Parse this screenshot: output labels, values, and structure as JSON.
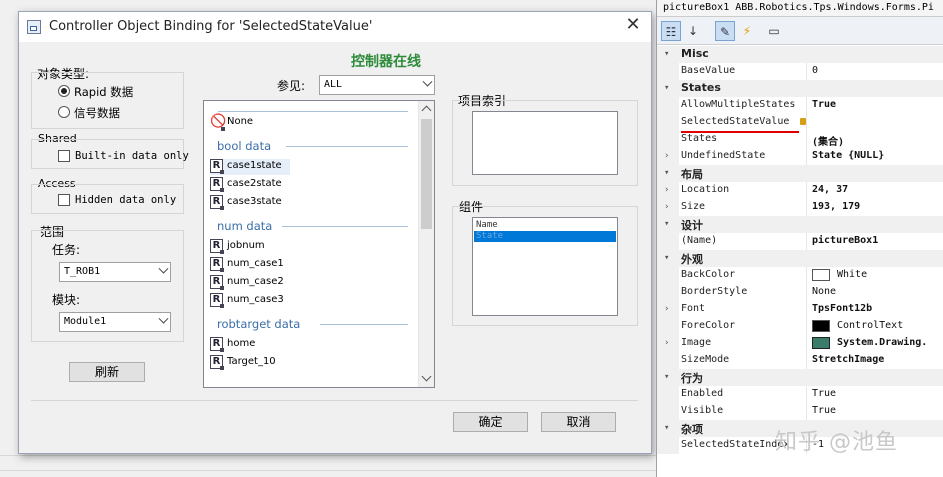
{
  "dialog": {
    "title": "Controller Object Binding for 'SelectedStateValue'",
    "online_label": "控制器在线",
    "object_type": {
      "label": "对象类型:",
      "rapid": "Rapid 数据",
      "signal": "信号数据"
    },
    "shared": {
      "label": "Shared",
      "builtin": "Built-in data only"
    },
    "access": {
      "label": "Access",
      "hidden": "Hidden data only"
    },
    "scope": {
      "label": "范围",
      "task_label": "任务:",
      "task_value": "T_ROB1",
      "module_label": "模块:",
      "module_value": "Module1"
    },
    "refresh_button": "刷新",
    "ref_label": "参见:",
    "ref_value": "ALL",
    "list": {
      "none": "None",
      "bool_header": "bool data",
      "bool_items": [
        "case1state",
        "case2state",
        "case3state"
      ],
      "num_header": "num data",
      "num_items": [
        "jobnum",
        "num_case1",
        "num_case2",
        "num_case3"
      ],
      "robtarget_header": "robtarget data",
      "robtarget_items": [
        "home",
        "Target_10"
      ]
    },
    "item_index_label": "项目索引",
    "component_label": "组件",
    "component_header": "Name",
    "component_selected": "State",
    "ok_button": "确定",
    "cancel_button": "取消"
  },
  "properties": {
    "header": "pictureBox1 ABB.Robotics.Tps.Windows.Forms.Pi",
    "misc": {
      "category": "Misc",
      "base_value_name": "BaseValue",
      "base_value": "0"
    },
    "states": {
      "category": "States",
      "allow_multiple_name": "AllowMultipleStates",
      "allow_multiple_value": "True",
      "selected_state_value_name": "SelectedStateValue",
      "states_name": "States",
      "states_value": "(集合)",
      "undefined_state_name": "UndefinedState",
      "undefined_state_value": "State {NULL}"
    },
    "layout": {
      "category": "布局",
      "location_name": "Location",
      "location_value": "24, 37",
      "size_name": "Size",
      "size_value": "193, 179"
    },
    "design": {
      "category": "设计",
      "name_name": "(Name)",
      "name_value": "pictureBox1"
    },
    "appearance": {
      "category": "外观",
      "backcolor_name": "BackColor",
      "backcolor_value": "White",
      "borderstyle_name": "BorderStyle",
      "borderstyle_value": "None",
      "font_name": "Font",
      "font_value": "TpsFont12b",
      "forecolor_name": "ForeColor",
      "forecolor_value": "ControlText",
      "image_name": "Image",
      "image_value": "System.Drawing.",
      "sizemode_name": "SizeMode",
      "sizemode_value": "StretchImage"
    },
    "behavior": {
      "category": "行为",
      "enabled_name": "Enabled",
      "enabled_value": "True",
      "visible_name": "Visible",
      "visible_value": "True"
    },
    "misc2": {
      "category": "杂项",
      "selected_state_index_name": "SelectedStateIndex",
      "selected_state_index_value": "-1"
    }
  },
  "watermark": "知乎 @池鱼",
  "colors": {
    "online_green": "#2e8b3a",
    "selection_blue": "#0078d7",
    "red_underline": "#e00000",
    "category_blue": "#3b6fa8"
  }
}
